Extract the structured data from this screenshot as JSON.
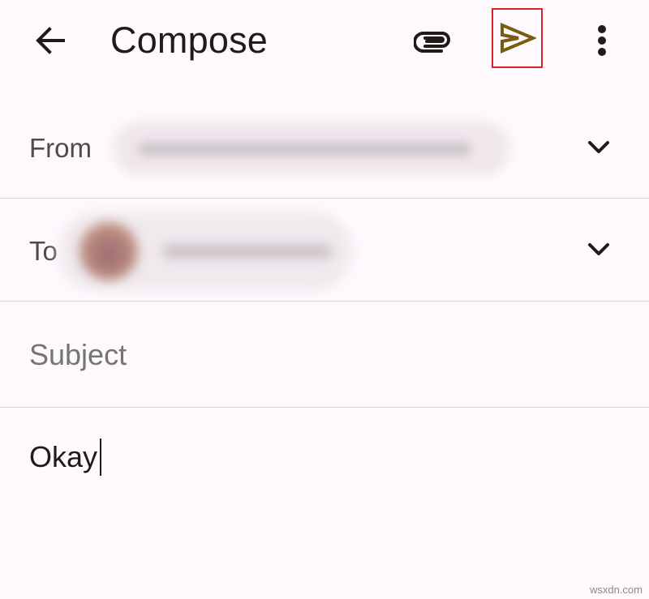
{
  "header": {
    "title": "Compose",
    "back_icon": "arrow-back-icon",
    "attach_icon": "paperclip-icon",
    "send_icon": "send-icon",
    "more_icon": "more-vert-icon"
  },
  "from": {
    "label": "From"
  },
  "to": {
    "label": "To"
  },
  "subject": {
    "placeholder": "Subject",
    "value": ""
  },
  "body": {
    "text": "Okay"
  },
  "watermark": "wsxdn.com",
  "colors": {
    "background": "#fdf9fd",
    "send_icon": "#7a5b12",
    "highlight_border": "#d8222a",
    "divider": "#dcd6d8"
  }
}
